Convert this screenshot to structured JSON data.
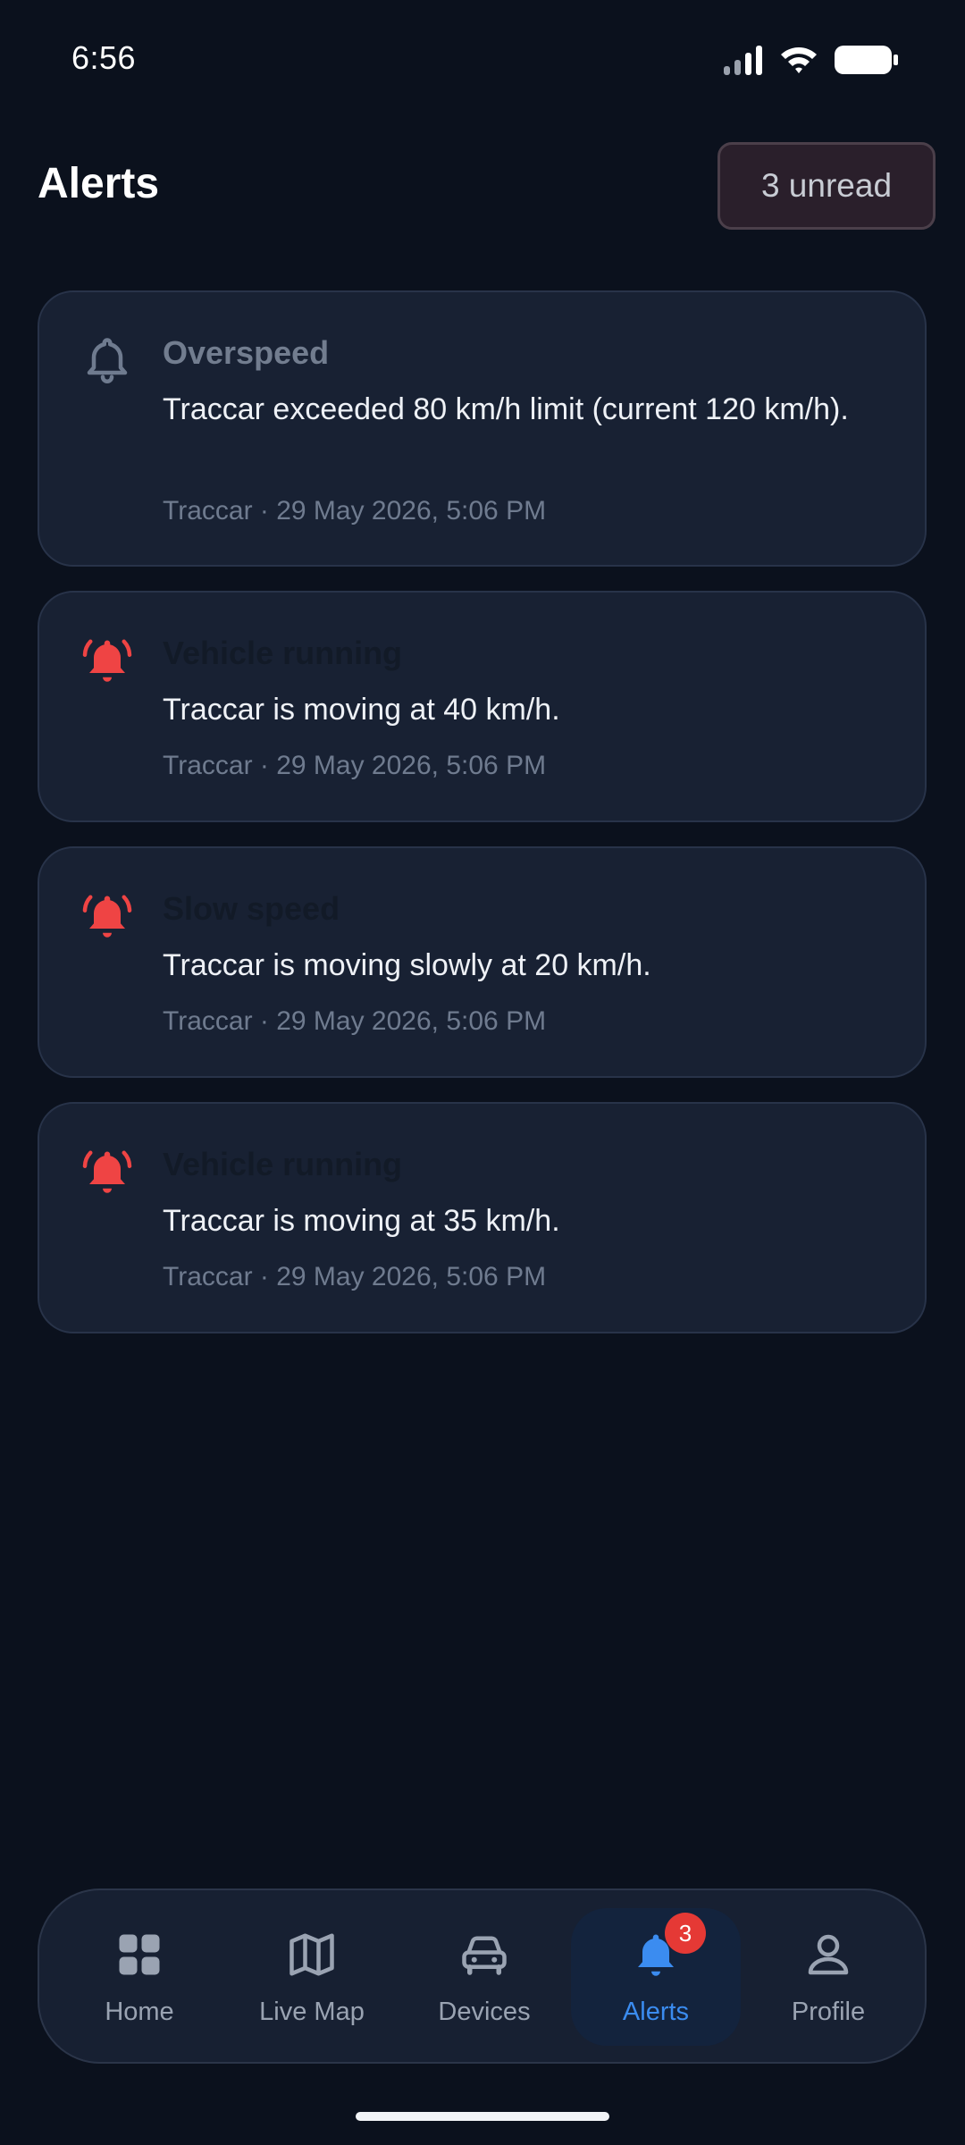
{
  "status_bar": {
    "time": "6:56"
  },
  "header": {
    "title": "Alerts",
    "unread_badge": "3 unread"
  },
  "alerts": [
    {
      "title": "Overspeed",
      "message": "Traccar exceeded 80 km/h limit (current 120 km/h).",
      "meta": "Traccar · 29 May 2026, 5:06 PM",
      "icon": "bell-outline-icon",
      "read": true
    },
    {
      "title": "Vehicle running",
      "message": "Traccar is moving at 40 km/h.",
      "meta": "Traccar · 29 May 2026, 5:06 PM",
      "icon": "bell-ringing-icon",
      "read": false
    },
    {
      "title": "Slow speed",
      "message": "Traccar is moving slowly at 20 km/h.",
      "meta": "Traccar · 29 May 2026, 5:06 PM",
      "icon": "bell-ringing-icon",
      "read": false
    },
    {
      "title": "Vehicle running",
      "message": "Traccar is moving at 35 km/h.",
      "meta": "Traccar · 29 May 2026, 5:06 PM",
      "icon": "bell-ringing-icon",
      "read": false
    }
  ],
  "nav": {
    "items": [
      {
        "label": "Home",
        "icon": "grid-icon"
      },
      {
        "label": "Live Map",
        "icon": "map-icon"
      },
      {
        "label": "Devices",
        "icon": "car-icon"
      },
      {
        "label": "Alerts",
        "icon": "bell-icon",
        "badge": "3",
        "active": true
      },
      {
        "label": "Profile",
        "icon": "person-icon"
      }
    ]
  },
  "colors": {
    "background": "#0b111d",
    "card": "#182133",
    "accent": "#3b8cf0",
    "alert_red": "#e53935"
  }
}
